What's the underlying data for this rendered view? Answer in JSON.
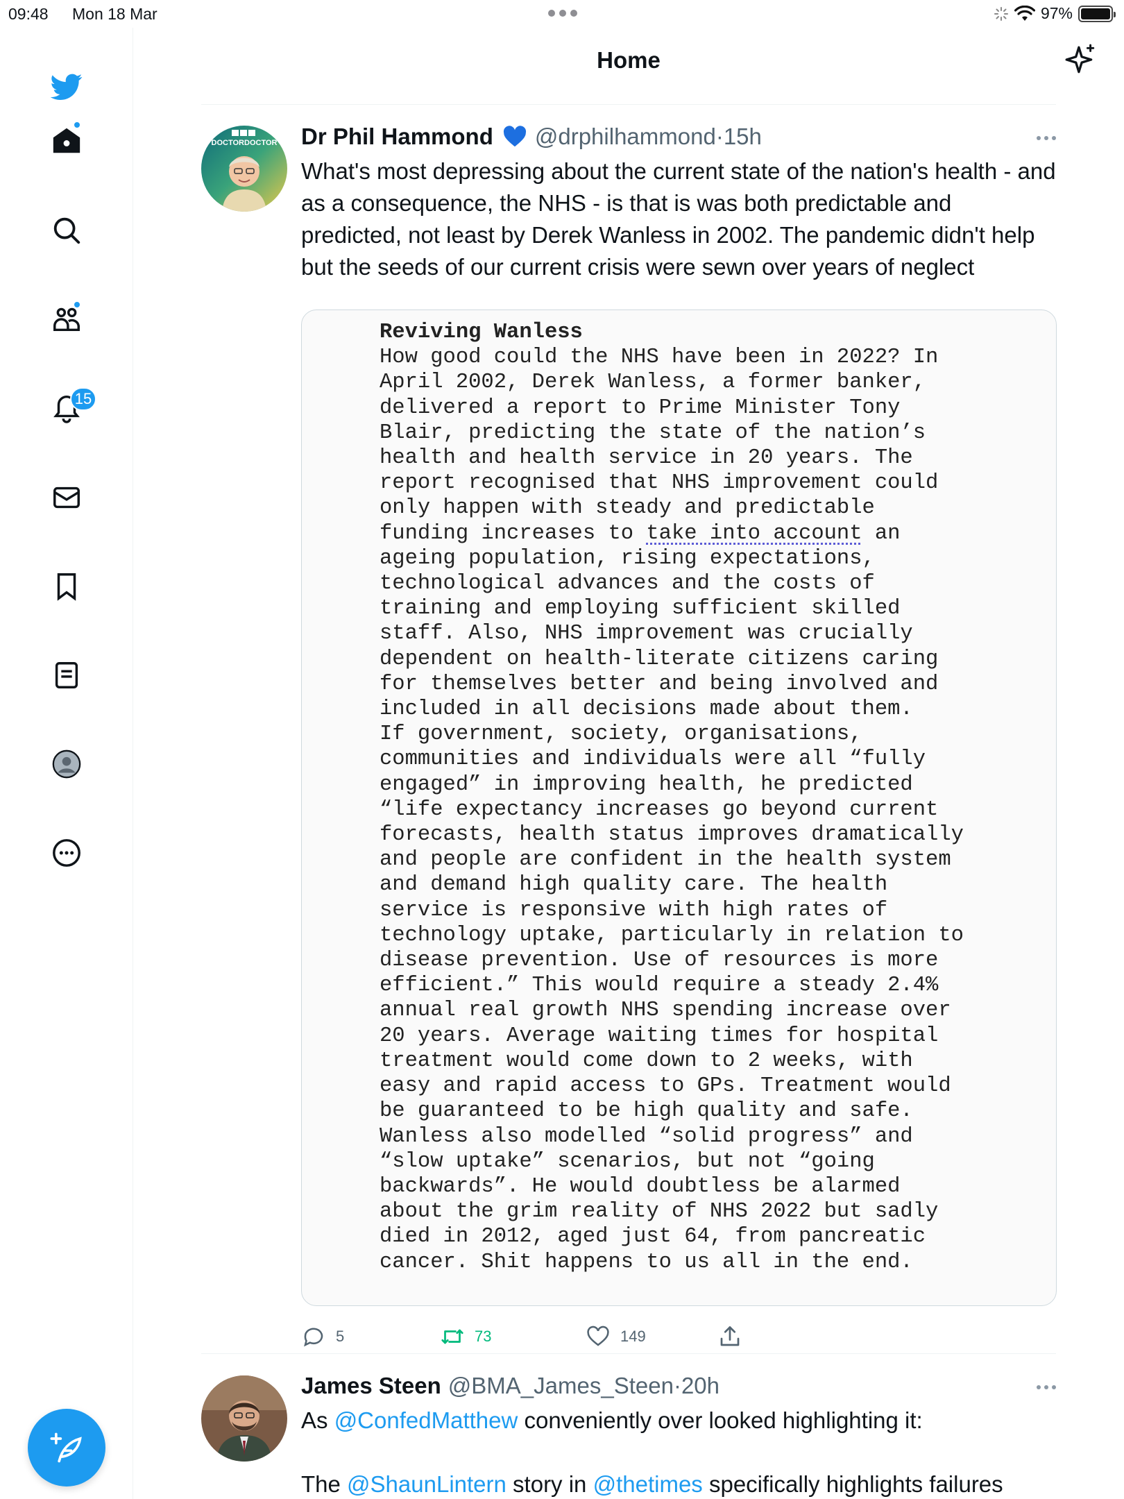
{
  "status_bar": {
    "time": "09:48",
    "date": "Mon 18 Mar",
    "battery": "97%"
  },
  "sidebar": {
    "notifications_count": "15",
    "items": [
      "home-icon",
      "search-icon",
      "communities-icon",
      "notifications-icon",
      "messages-icon",
      "bookmarks-icon",
      "lists-icon",
      "profile-icon",
      "more-icon"
    ]
  },
  "header": {
    "title": "Home"
  },
  "tweets": [
    {
      "name": "Dr Phil Hammond",
      "handle": "@drphilhammond",
      "sep": "·",
      "time": "15h",
      "avatar_text": "DOCTORDOCTOR",
      "text": "What's most depressing about the current state of the nation's health - and as a consequence, the NHS - is that is was both predictable and predicted, not least by Derek Wanless in 2002.  The pandemic didn't help but the seeds of our current crisis were sewn over years of neglect",
      "quote_image": {
        "title": "Reviving Wanless",
        "lines_before": "How good could the NHS have been in 2022? In\nApril 2002, Derek Wanless, a former banker,\ndelivered a report to Prime Minister Tony\nBlair, predicting the state of the nation’s\nhealth and health service in 20 years. The\nreport recognised that NHS improvement could\nonly happen with steady and predictable\nfunding increases to ",
        "squiggle": "take into account",
        "lines_after": " an\nageing population, rising expectations,\ntechnological advances and the costs of\ntraining and employing sufficient skilled\nstaff. Also, NHS improvement was crucially\ndependent on health-literate citizens caring\nfor themselves better and being involved and\nincluded in all decisions made about them.\nIf government, society, organisations,\ncommunities and individuals were all “fully\nengaged” in improving health, he predicted\n“life expectancy increases go beyond current\nforecasts, health status improves dramatically\nand people are confident in the health system\nand demand high quality care. The health\nservice is responsive with high rates of\ntechnology uptake, particularly in relation to\ndisease prevention. Use of resources is more\nefficient.” This would require a steady 2.4%\nannual real growth NHS spending increase over\n20 years. Average waiting times for hospital\ntreatment would come down to 2 weeks, with\neasy and rapid access to GPs. Treatment would\nbe guaranteed to be high quality and safe.\nWanless also modelled “solid progress” and\n“slow uptake” scenarios, but not “going\nbackwards”. He would doubtless be alarmed\nabout the grim reality of NHS 2022 but sadly\ndied in 2012, aged just 64, from pancreatic\ncancer. Shit happens to us all in the end."
      },
      "replies": "5",
      "retweets": "73",
      "likes": "149"
    },
    {
      "name": "James Steen",
      "handle": "@BMA_James_Steen",
      "sep": "·",
      "time": "20h",
      "line1_pre": "As ",
      "line1_link": "@ConfedMatthew",
      "line1_post": " conveniently over looked highlighting it:",
      "line2_pre": "The ",
      "line2_link1": "@ShaunLintern",
      "line2_mid": " story in ",
      "line2_link2": "@thetimes",
      "line2_post": " specifically highlights failures"
    }
  ],
  "colors": {
    "accent": "#1d9bf0",
    "retweet": "#00ba7c",
    "muted": "#536471"
  }
}
